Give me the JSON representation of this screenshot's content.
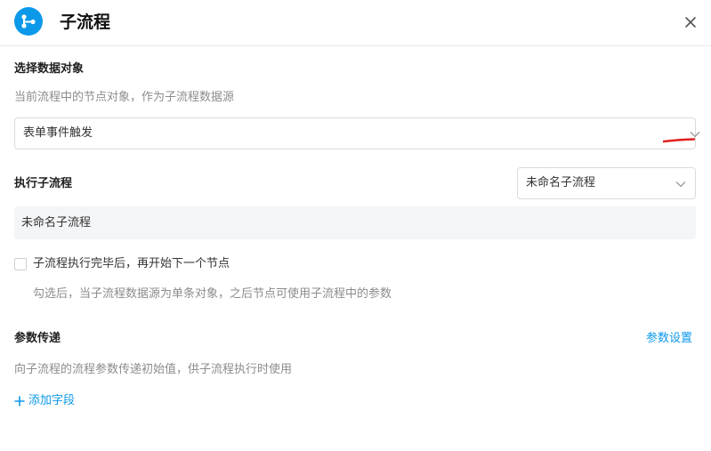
{
  "header": {
    "title": "子流程",
    "icon": "subflow-icon",
    "close_icon": "close-icon"
  },
  "data_object": {
    "title": "选择数据对象",
    "hint": "当前流程中的节点对象，作为子流程数据源",
    "selected": "表单事件触发"
  },
  "execute": {
    "title": "执行子流程",
    "selected": "未命名子流程",
    "name_value": "未命名子流程",
    "checkbox_label": "子流程执行完毕后，再开始下一个节点",
    "checkbox_checked": false,
    "checkbox_hint": "勾选后，当子流程数据源为单条对象，之后节点可使用子流程中的参数"
  },
  "params": {
    "title": "参数传递",
    "settings_link": "参数设置",
    "hint": "向子流程的流程参数传递初始值，供子流程执行时使用",
    "add_field": "添加字段"
  },
  "colors": {
    "accent": "#0d99ea",
    "annotation": "#e0201f",
    "text_secondary": "#8c8c8c",
    "name_box_bg": "#f4f5f7"
  }
}
